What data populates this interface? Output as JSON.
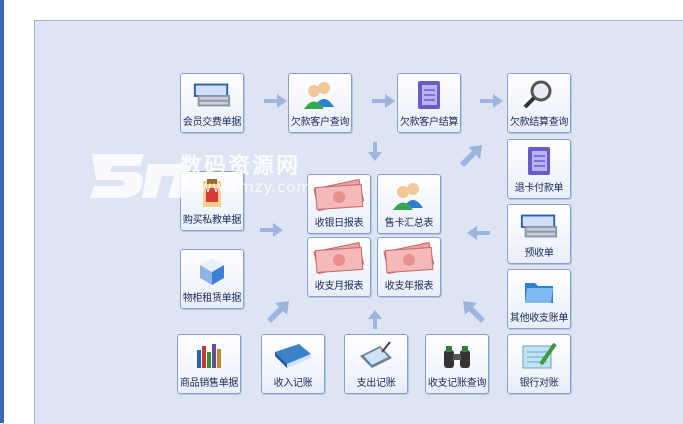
{
  "tiles": {
    "member_fee": "会员交费单据",
    "arrears_customer_query": "欠款客户查询",
    "arrears_customer_settle": "欠款客户结算",
    "arrears_settle_query": "欠款结算查询",
    "card_refund": "退卡付款单",
    "buy_private_lessons": "购买私教单据",
    "cashier_daily": "收银日报表",
    "card_sales_summary": "售卡汇总表",
    "advance_receipt": "预收单",
    "locker_rental": "物柜租赁单据",
    "cashflow_monthly": "收支月报表",
    "cashflow_yearly": "收支年报表",
    "other_income_expense": "其他收支账单",
    "product_sales": "商品销售单据",
    "income_entry": "收入记账",
    "expense_entry": "支出记账",
    "cashflow_query": "收支记账查询",
    "bank_reconcile": "银行对账"
  },
  "watermark": {
    "title": "数码资源网",
    "url": "www.smzy.com"
  },
  "colors": {
    "panel": "#dde5f4",
    "tile_border": "#8aa0c7",
    "arrow": "#9fb4dc"
  }
}
